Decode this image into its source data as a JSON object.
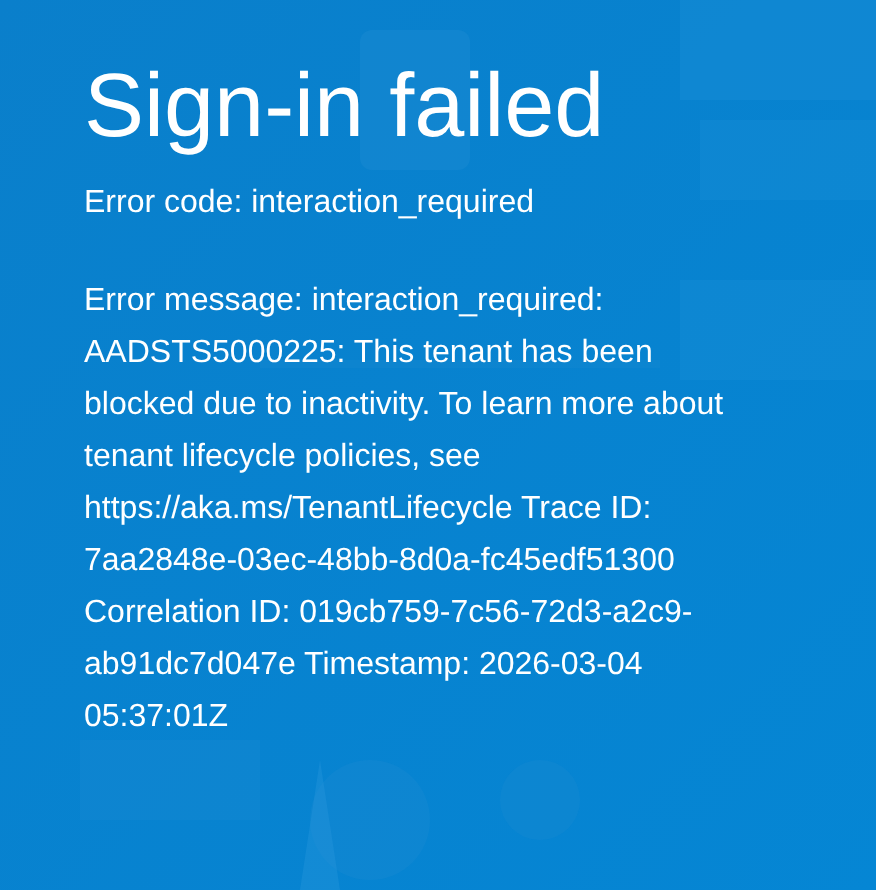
{
  "title": "Sign-in failed",
  "error_code": "Error code: interaction_required",
  "error_message": "Error message: interaction_required: AADSTS5000225: This tenant has been blocked due to inactivity. To learn more about tenant lifecycle policies, see https://aka.ms/TenantLifecycle Trace ID: 7aa2848e-03ec-48bb-8d0a-fc45edf51300 Correlation ID: 019cb759-7c56-72d3-a2c9-ab91dc7d047e Timestamp: 2026-03-04 05:37:01Z"
}
